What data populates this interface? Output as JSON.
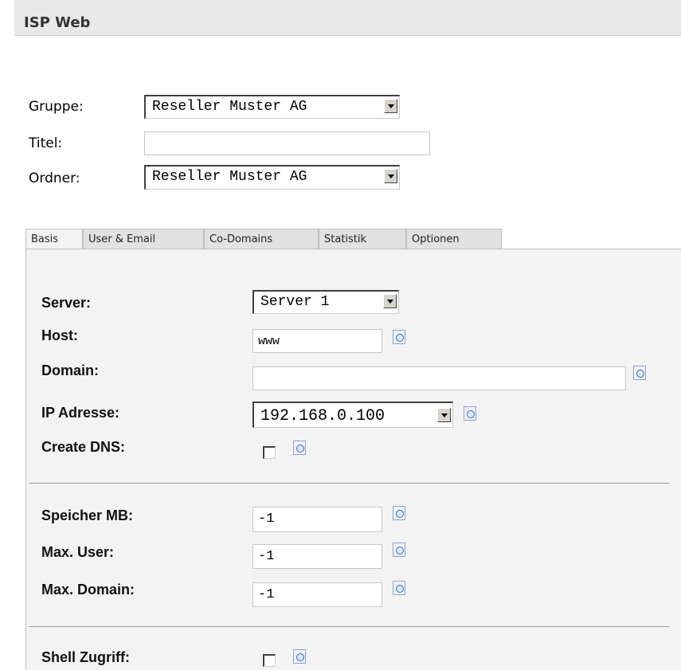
{
  "window": {
    "title": "ISP Web"
  },
  "header_form": {
    "gruppe": {
      "label": "Gruppe:",
      "value": "Reseller Muster AG"
    },
    "titel": {
      "label": "Titel:",
      "value": ""
    },
    "ordner": {
      "label": "Ordner:",
      "value": "Reseller Muster AG"
    }
  },
  "tabs": [
    {
      "label": "Basis",
      "active": true
    },
    {
      "label": "User & Email",
      "active": false
    },
    {
      "label": "Co-Domains",
      "active": false
    },
    {
      "label": "Statistik",
      "active": false
    },
    {
      "label": "Optionen",
      "active": false
    }
  ],
  "basis": {
    "server": {
      "label": "Server:",
      "value": "Server 1"
    },
    "host": {
      "label": "Host:",
      "value": "www"
    },
    "domain": {
      "label": "Domain:",
      "value": ""
    },
    "ip": {
      "label": "IP Adresse:",
      "value": "192.168.0.100"
    },
    "create_dns": {
      "label": "Create DNS:",
      "checked": false
    },
    "speicher": {
      "label": "Speicher MB:",
      "value": "-1"
    },
    "max_user": {
      "label": "Max. User:",
      "value": "-1"
    },
    "max_domain": {
      "label": "Max. Domain:",
      "value": "-1"
    },
    "shell": {
      "label": "Shell Zugriff:",
      "checked": false
    }
  },
  "icons": {
    "info": "info-icon",
    "dropdown": "chevron-down-icon"
  },
  "colors": {
    "titlebar": "#e8e8e8",
    "panel": "#f3f3f3",
    "tab": "#e2e2e2",
    "title_text": "#333333"
  }
}
